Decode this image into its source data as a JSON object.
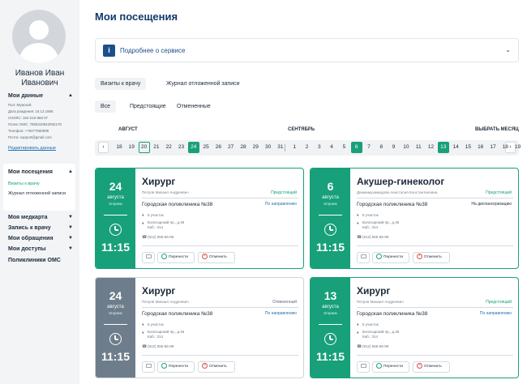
{
  "user": {
    "name": "Иванов Иван Иванович"
  },
  "profile": {
    "title": "Мои данные",
    "fields": [
      "Пол: Мужской",
      "Дата рождения: 16.12.1986",
      "СНИЛС: 152-215-866 57",
      "Полис ОМС: 7855310842082178",
      "Телефон: +79477560998",
      "Почта: support@gmail.com"
    ],
    "edit_link": "Редактировать данные"
  },
  "nav": {
    "visits": "Мои посещения",
    "visits_sub": [
      "Визиты к врачу",
      "Журнал отложенной записи"
    ],
    "items": [
      "Моя медкарта",
      "Запись к врачу",
      "Мои обращения",
      "Мои доступы",
      "Поликлиники ОМС"
    ]
  },
  "page": {
    "title": "Мои посещения",
    "info_label": "Подробнее о сервисе",
    "info_icon": "i",
    "tabs": [
      "Визиты к врачу",
      "Журнал отложенной записи"
    ],
    "filters": [
      "Все",
      "Предстоящие",
      "Отмененные"
    ]
  },
  "calendar": {
    "month1": "АВГУСТ",
    "month2": "СЕНТЯБРЬ",
    "choose_month": "ВЫБРАТЬ МЕСЯЦ",
    "prev": "‹",
    "next": "›",
    "days_aug": [
      "18",
      "19",
      "20",
      "21",
      "22",
      "23",
      "24",
      "25",
      "26",
      "27",
      "28",
      "29",
      "30",
      "31"
    ],
    "days_sep": [
      "1",
      "2",
      "3",
      "4",
      "5",
      "6",
      "7",
      "8",
      "9",
      "10",
      "11",
      "12",
      "13",
      "14",
      "15",
      "16",
      "17",
      "18",
      "19"
    ]
  },
  "cards": [
    {
      "day": "24",
      "month": "августа",
      "weekday": "вторник",
      "time": "11:15",
      "specialty": "Хирург",
      "doctor": "Петров Михаил Андреевич",
      "status": "Предстоящий",
      "clinic": "Городская поликлиника №38",
      "referral": "По направлению",
      "area": "5 участок",
      "address": "Богатырский пр., д.46",
      "room": "Каб.: 314",
      "phone": "(812) 555-66-99",
      "move": "Перенести",
      "cancel": "Отменить"
    },
    {
      "day": "6",
      "month": "августа",
      "weekday": "вторник",
      "time": "11:15",
      "specialty": "Акушер-гинеколог",
      "doctor": "Деминмухамедова Анастасия Константиновна",
      "status": "Предстоящий",
      "clinic": "Городская поликлиника №38",
      "referral": "На диспансеризацию",
      "area": "5 участок",
      "address": "Богатырский пр., д.46",
      "room": "Каб.: 314",
      "phone": "(812) 555-66-99",
      "move": "Перенести",
      "cancel": "Отменить"
    },
    {
      "day": "24",
      "month": "августа",
      "weekday": "вторник",
      "time": "11:15",
      "specialty": "Хирург",
      "doctor": "Петров Михаил Андреевич",
      "status": "Отмененный",
      "clinic": "Городская поликлиника №38",
      "referral": "По направлению",
      "area": "5 участок",
      "address": "Богатырский пр., д.46",
      "room": "Каб.: 314",
      "phone": "(812) 555-66-99",
      "move": "Перенести",
      "cancel": "Отменить"
    },
    {
      "day": "13",
      "month": "августа",
      "weekday": "вторник",
      "time": "11:15",
      "specialty": "Хирург",
      "doctor": "Петров Михаил Андреевич",
      "status": "Предстоящий",
      "clinic": "Городская поликлиника №38",
      "referral": "По направлению",
      "area": "5 участок",
      "address": "Богатырский пр., д.46",
      "room": "Каб.: 314",
      "phone": "(812) 555-66-99",
      "move": "Перенести",
      "cancel": "Отменить"
    }
  ],
  "colors": {
    "accent": "#18a07a",
    "title": "#133a6b",
    "muted_card": "#6e7d8b",
    "cancel": "#d9534f"
  }
}
